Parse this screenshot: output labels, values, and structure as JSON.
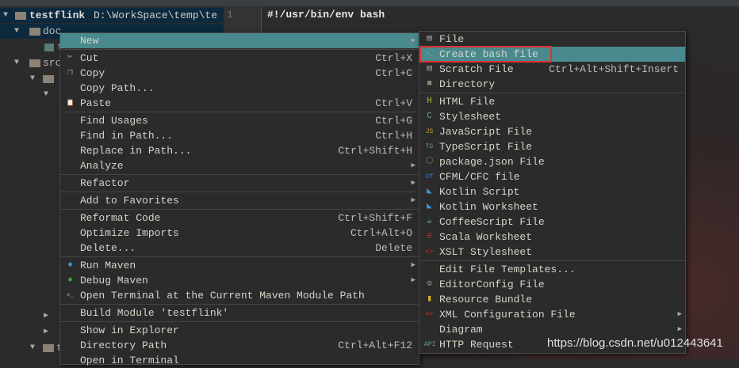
{
  "tree": {
    "root": "testflink",
    "root_path": "D:\\WorkSpace\\temp\\te",
    "doc": "doc",
    "src": "src",
    "t_item": "t",
    "letter_t": "t"
  },
  "editor": {
    "line_number": "1",
    "code": "#!/usr/bin/env bash"
  },
  "context_menu": {
    "groups": [
      [
        {
          "label": "New",
          "submenu": true,
          "highlighted": true
        }
      ],
      [
        {
          "label": "Cut",
          "shortcut": "Ctrl+X",
          "icon": "scissors-icon"
        },
        {
          "label": "Copy",
          "shortcut": "Ctrl+C",
          "icon": "copy-icon"
        },
        {
          "label": "Copy Path..."
        },
        {
          "label": "Paste",
          "shortcut": "Ctrl+V",
          "icon": "paste-icon"
        }
      ],
      [
        {
          "label": "Find Usages",
          "shortcut": "Ctrl+G"
        },
        {
          "label": "Find in Path...",
          "shortcut": "Ctrl+H"
        },
        {
          "label": "Replace in Path...",
          "shortcut": "Ctrl+Shift+H"
        },
        {
          "label": "Analyze",
          "submenu": true
        }
      ],
      [
        {
          "label": "Refactor",
          "submenu": true
        }
      ],
      [
        {
          "label": "Add to Favorites",
          "submenu": true
        }
      ],
      [
        {
          "label": "Reformat Code",
          "shortcut": "Ctrl+Shift+F"
        },
        {
          "label": "Optimize Imports",
          "shortcut": "Ctrl+Alt+O"
        },
        {
          "label": "Delete...",
          "shortcut": "Delete"
        }
      ],
      [
        {
          "label": "Run Maven",
          "submenu": true,
          "icon": "maven-run-icon"
        },
        {
          "label": "Debug Maven",
          "submenu": true,
          "icon": "maven-debug-icon"
        },
        {
          "label": "Open Terminal at the Current Maven Module Path",
          "icon": "terminal-icon"
        }
      ],
      [
        {
          "label": "Build Module 'testflink'"
        }
      ],
      [
        {
          "label": "Show in Explorer"
        },
        {
          "label": "Directory Path",
          "shortcut": "Ctrl+Alt+F12"
        },
        {
          "label": "Open in Terminal"
        }
      ]
    ]
  },
  "new_submenu": {
    "groups": [
      [
        {
          "label": "File",
          "icon": "file-icon"
        },
        {
          "label": "Create bash file",
          "icon": "bash-file-icon",
          "highlighted": true
        },
        {
          "label": "Scratch File",
          "shortcut": "Ctrl+Alt+Shift+Insert",
          "icon": "scratch-file-icon"
        },
        {
          "label": "Directory",
          "icon": "folder-icon"
        }
      ],
      [
        {
          "label": "HTML File",
          "icon": "html-file-icon"
        },
        {
          "label": "Stylesheet",
          "icon": "css-file-icon"
        },
        {
          "label": "JavaScript File",
          "icon": "js-file-icon"
        },
        {
          "label": "TypeScript File",
          "icon": "ts-file-icon"
        },
        {
          "label": "package.json File",
          "icon": "nodejs-icon"
        },
        {
          "label": "CFML/CFC file",
          "icon": "cfml-icon"
        },
        {
          "label": "Kotlin Script",
          "icon": "kotlin-icon"
        },
        {
          "label": "Kotlin Worksheet",
          "icon": "kotlin-icon"
        },
        {
          "label": "CoffeeScript File",
          "icon": "coffeescript-icon"
        },
        {
          "label": "Scala Worksheet",
          "icon": "scala-icon"
        },
        {
          "label": "XSLT Stylesheet",
          "icon": "xslt-icon"
        }
      ],
      [
        {
          "label": "Edit File Templates..."
        },
        {
          "label": "EditorConfig File",
          "icon": "gear-icon"
        },
        {
          "label": "Resource Bundle",
          "icon": "resource-bundle-icon"
        },
        {
          "label": "XML Configuration File",
          "submenu": true,
          "icon": "xml-icon"
        },
        {
          "label": "Diagram",
          "submenu": true
        },
        {
          "label": "HTTP Request",
          "icon": "api-icon"
        }
      ]
    ]
  },
  "highlight_color": "#e03030",
  "watermark": "https://blog.csdn.net/u012443641"
}
